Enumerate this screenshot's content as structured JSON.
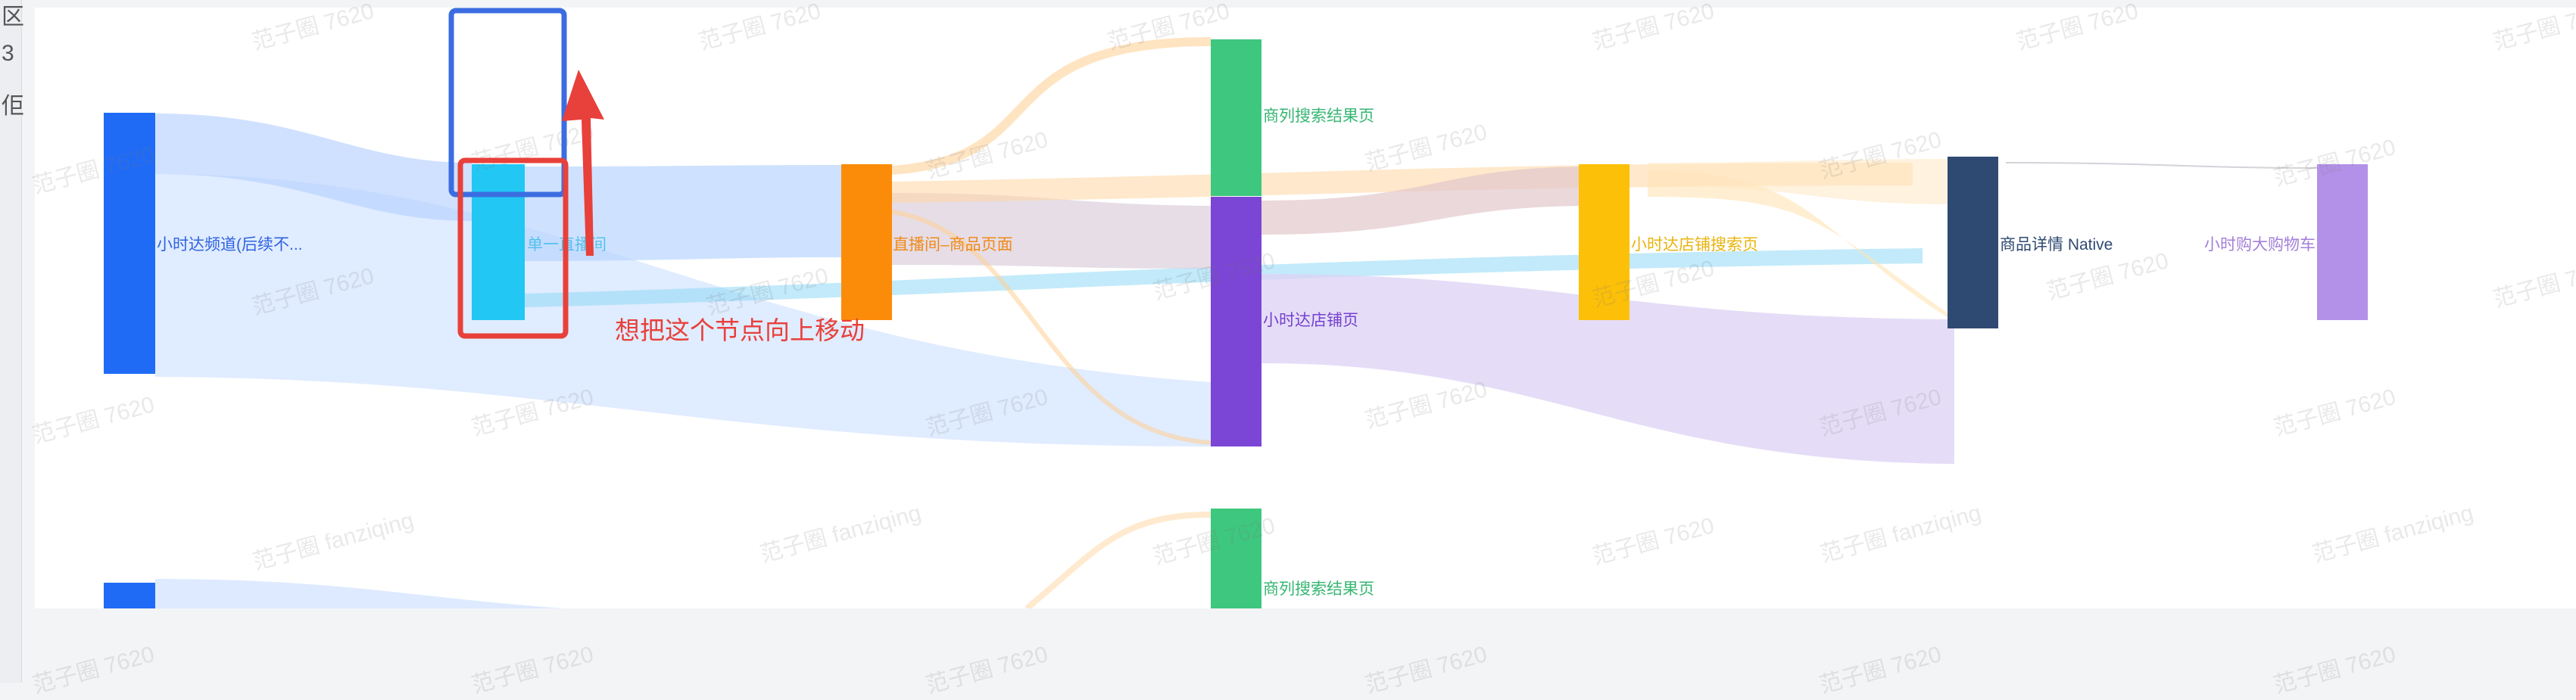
{
  "left_edge_glyphs": [
    "区",
    "3",
    "佢"
  ],
  "watermark_text": "范子圈 7620",
  "watermark_alt_text": "范子圈 fanziqing",
  "annotation": {
    "text": "想把这个节点向上移动"
  },
  "colors": {
    "annotation_red": "#e8403b",
    "annotation_blue": "#3b6de1",
    "link_blue": "#c7dcff",
    "link_orange": "#ffd8a8",
    "link_purple": "#dcd2f4"
  },
  "diagram": {
    "type": "sankey",
    "nodes": [
      {
        "id": "n1",
        "label": "小时达频道(后续不...",
        "color": "#1f6bf6"
      },
      {
        "id": "n2",
        "label": "单一直播间",
        "color": "#22c7f3"
      },
      {
        "id": "n3",
        "label": "直播间–商品页面",
        "color": "#fb8c0a"
      },
      {
        "id": "n4",
        "label": "商列搜索结果页",
        "color": "#3ec77f"
      },
      {
        "id": "n5",
        "label": "小时达店铺页",
        "color": "#7b45d5"
      },
      {
        "id": "n6",
        "label": "小时达店铺搜索页",
        "color": "#fdc008"
      },
      {
        "id": "n7",
        "label": "商品详情 Native",
        "color": "#2f4a72"
      },
      {
        "id": "n8",
        "label": "小时购大购物车",
        "color": "#b391e8"
      },
      {
        "id": "n9",
        "label": "商列搜索结果页",
        "color": "#3ec77f"
      }
    ],
    "links": [
      {
        "source": "n1",
        "target": "n2"
      },
      {
        "source": "n1",
        "target": "n5"
      },
      {
        "source": "n2",
        "target": "n3"
      },
      {
        "source": "n2",
        "target": "n6"
      },
      {
        "source": "n3",
        "target": "n4"
      },
      {
        "source": "n3",
        "target": "n5"
      },
      {
        "source": "n3",
        "target": "n7"
      },
      {
        "source": "n5",
        "target": "n7"
      },
      {
        "source": "n6",
        "target": "n7"
      },
      {
        "source": "n7",
        "target": "n8"
      }
    ]
  }
}
